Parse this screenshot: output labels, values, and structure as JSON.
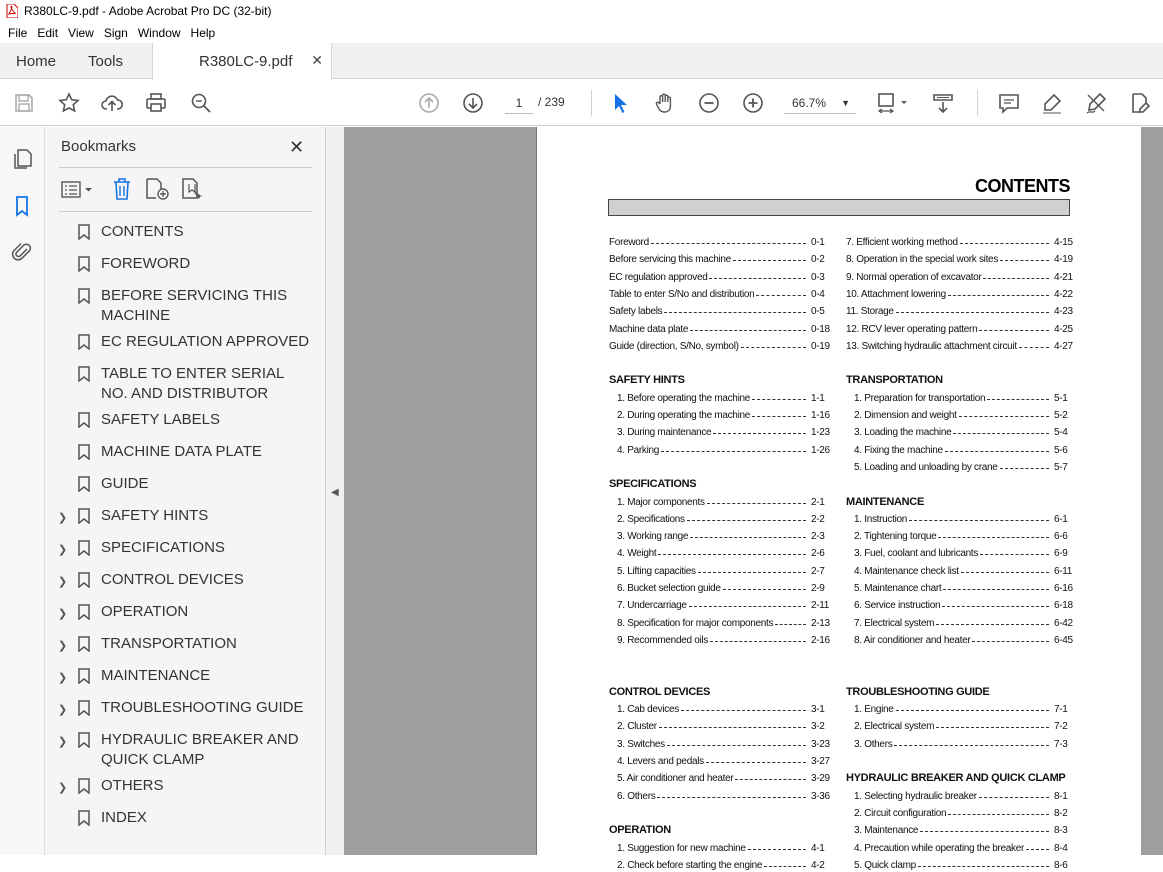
{
  "window": {
    "title": "R380LC-9.pdf - Adobe Acrobat Pro DC (32-bit)"
  },
  "menu": [
    "File",
    "Edit",
    "View",
    "Sign",
    "Window",
    "Help"
  ],
  "tabs": {
    "home": "Home",
    "tools": "Tools",
    "doc": "R380LC-9.pdf"
  },
  "toolbar": {
    "page_current": "1",
    "page_total": "/ 239",
    "zoom": "66.7%"
  },
  "bookmarks": {
    "title": "Bookmarks",
    "items": [
      {
        "label": "CONTENTS",
        "expandable": false
      },
      {
        "label": "FOREWORD",
        "expandable": false
      },
      {
        "label": "BEFORE SERVICING THIS MACHINE",
        "expandable": false
      },
      {
        "label": "EC REGULATION APPROVED",
        "expandable": false
      },
      {
        "label": "TABLE TO ENTER SERIAL NO. AND DISTRIBUTOR",
        "expandable": false
      },
      {
        "label": "SAFETY LABELS",
        "expandable": false
      },
      {
        "label": "MACHINE DATA PLATE",
        "expandable": false
      },
      {
        "label": "GUIDE",
        "expandable": false
      },
      {
        "label": "SAFETY HINTS",
        "expandable": true
      },
      {
        "label": "SPECIFICATIONS",
        "expandable": true
      },
      {
        "label": "CONTROL DEVICES",
        "expandable": true
      },
      {
        "label": "OPERATION",
        "expandable": true
      },
      {
        "label": "TRANSPORTATION",
        "expandable": true
      },
      {
        "label": "MAINTENANCE",
        "expandable": true
      },
      {
        "label": "TROUBLESHOOTING GUIDE",
        "expandable": true
      },
      {
        "label": "HYDRAULIC BREAKER AND QUICK CLAMP",
        "expandable": true
      },
      {
        "label": "OTHERS",
        "expandable": true
      },
      {
        "label": "INDEX",
        "expandable": false
      }
    ]
  },
  "document": {
    "heading": "CONTENTS",
    "left": [
      {
        "type": "entry",
        "label": "Foreword",
        "page": "0-1"
      },
      {
        "type": "entry",
        "label": "Before servicing this machine",
        "page": "0-2"
      },
      {
        "type": "entry",
        "label": "EC regulation approved",
        "page": "0-3"
      },
      {
        "type": "entry",
        "label": "Table to enter S/No and distribution",
        "page": "0-4"
      },
      {
        "type": "entry",
        "label": "Safety labels",
        "page": "0-5"
      },
      {
        "type": "entry",
        "label": "Machine data plate",
        "page": "0-18"
      },
      {
        "type": "entry",
        "label": "Guide (direction, S/No, symbol)",
        "page": "0-19"
      },
      {
        "type": "gap"
      },
      {
        "type": "section",
        "label": "SAFETY HINTS"
      },
      {
        "type": "entry",
        "label": "1. Before operating the machine",
        "page": "1-1",
        "indent": true
      },
      {
        "type": "entry",
        "label": "2. During operating the machine",
        "page": "1-16",
        "indent": true
      },
      {
        "type": "entry",
        "label": "3. During maintenance",
        "page": "1-23",
        "indent": true
      },
      {
        "type": "entry",
        "label": "4. Parking",
        "page": "1-26",
        "indent": true
      },
      {
        "type": "gap"
      },
      {
        "type": "section",
        "label": "SPECIFICATIONS"
      },
      {
        "type": "entry",
        "label": "1. Major components",
        "page": "2-1",
        "indent": true
      },
      {
        "type": "entry",
        "label": "2. Specifications",
        "page": "2-2",
        "indent": true
      },
      {
        "type": "entry",
        "label": "3. Working range",
        "page": "2-3",
        "indent": true
      },
      {
        "type": "entry",
        "label": "4. Weight",
        "page": "2-6",
        "indent": true
      },
      {
        "type": "entry",
        "label": "5. Lifting capacities",
        "page": "2-7",
        "indent": true
      },
      {
        "type": "entry",
        "label": "6. Bucket selection guide",
        "page": "2-9",
        "indent": true
      },
      {
        "type": "entry",
        "label": "7. Undercarriage",
        "page": "2-11",
        "indent": true
      },
      {
        "type": "entry",
        "label": "8. Specification for major components",
        "page": "2-13",
        "indent": true
      },
      {
        "type": "entry",
        "label": "9. Recommended oils",
        "page": "2-16",
        "indent": true
      },
      {
        "type": "gap"
      },
      {
        "type": "gap"
      },
      {
        "type": "section",
        "label": "CONTROL DEVICES"
      },
      {
        "type": "entry",
        "label": "1. Cab devices",
        "page": "3-1",
        "indent": true
      },
      {
        "type": "entry",
        "label": "2. Cluster",
        "page": "3-2",
        "indent": true
      },
      {
        "type": "entry",
        "label": "3. Switches",
        "page": "3-23",
        "indent": true
      },
      {
        "type": "entry",
        "label": "4. Levers and pedals",
        "page": "3-27",
        "indent": true
      },
      {
        "type": "entry",
        "label": "5. Air conditioner and heater",
        "page": "3-29",
        "indent": true
      },
      {
        "type": "entry",
        "label": "6. Others",
        "page": "3-36",
        "indent": true
      },
      {
        "type": "gap"
      },
      {
        "type": "section",
        "label": "OPERATION"
      },
      {
        "type": "entry",
        "label": "1. Suggestion for new machine",
        "page": "4-1",
        "indent": true
      },
      {
        "type": "entry",
        "label": "2. Check before starting the engine",
        "page": "4-2",
        "indent": true
      }
    ],
    "right": [
      {
        "type": "entry",
        "label": "7. Efficient working method",
        "page": "4-15"
      },
      {
        "type": "entry",
        "label": "8. Operation in the special work sites",
        "page": "4-19"
      },
      {
        "type": "entry",
        "label": "9. Normal operation of excavator",
        "page": "4-21"
      },
      {
        "type": "entry",
        "label": "10. Attachment lowering",
        "page": "4-22"
      },
      {
        "type": "entry",
        "label": "11. Storage",
        "page": "4-23"
      },
      {
        "type": "entry",
        "label": "12. RCV lever operating pattern",
        "page": "4-25"
      },
      {
        "type": "entry",
        "label": "13. Switching hydraulic attachment circuit",
        "page": "4-27"
      },
      {
        "type": "gap"
      },
      {
        "type": "section",
        "label": "TRANSPORTATION"
      },
      {
        "type": "entry",
        "label": "1. Preparation for transportation",
        "page": "5-1",
        "indent": true
      },
      {
        "type": "entry",
        "label": "2. Dimension and weight",
        "page": "5-2",
        "indent": true
      },
      {
        "type": "entry",
        "label": "3. Loading the machine",
        "page": "5-4",
        "indent": true
      },
      {
        "type": "entry",
        "label": "4. Fixing the machine",
        "page": "5-6",
        "indent": true
      },
      {
        "type": "entry",
        "label": "5. Loading and unloading by crane",
        "page": "5-7",
        "indent": true
      },
      {
        "type": "gap"
      },
      {
        "type": "section",
        "label": "MAINTENANCE"
      },
      {
        "type": "entry",
        "label": "1. Instruction",
        "page": "6-1",
        "indent": true
      },
      {
        "type": "entry",
        "label": "2. Tightening torque",
        "page": "6-6",
        "indent": true
      },
      {
        "type": "entry",
        "label": "3. Fuel, coolant and lubricants",
        "page": "6-9",
        "indent": true
      },
      {
        "type": "entry",
        "label": "4. Maintenance check list",
        "page": "6-11",
        "indent": true
      },
      {
        "type": "entry",
        "label": "5. Maintenance chart",
        "page": "6-16",
        "indent": true
      },
      {
        "type": "entry",
        "label": "6. Service instruction",
        "page": "6-18",
        "indent": true
      },
      {
        "type": "entry",
        "label": "7. Electrical system",
        "page": "6-42",
        "indent": true
      },
      {
        "type": "entry",
        "label": "8. Air conditioner and heater",
        "page": "6-45",
        "indent": true
      },
      {
        "type": "gap"
      },
      {
        "type": "gap"
      },
      {
        "type": "section",
        "label": "TROUBLESHOOTING GUIDE"
      },
      {
        "type": "entry",
        "label": "1. Engine",
        "page": "7-1",
        "indent": true
      },
      {
        "type": "entry",
        "label": "2. Electrical system",
        "page": "7-2",
        "indent": true
      },
      {
        "type": "entry",
        "label": "3. Others",
        "page": "7-3",
        "indent": true
      },
      {
        "type": "gap"
      },
      {
        "type": "section",
        "label": "HYDRAULIC BREAKER AND QUICK CLAMP"
      },
      {
        "type": "entry",
        "label": "1. Selecting hydraulic breaker",
        "page": "8-1",
        "indent": true
      },
      {
        "type": "entry",
        "label": "2. Circuit configuration",
        "page": "8-2",
        "indent": true
      },
      {
        "type": "entry",
        "label": "3. Maintenance",
        "page": "8-3",
        "indent": true
      },
      {
        "type": "entry",
        "label": "4. Precaution while operating the breaker",
        "page": "8-4",
        "indent": true
      },
      {
        "type": "entry",
        "label": "5. Quick clamp",
        "page": "8-6",
        "indent": true
      }
    ]
  }
}
